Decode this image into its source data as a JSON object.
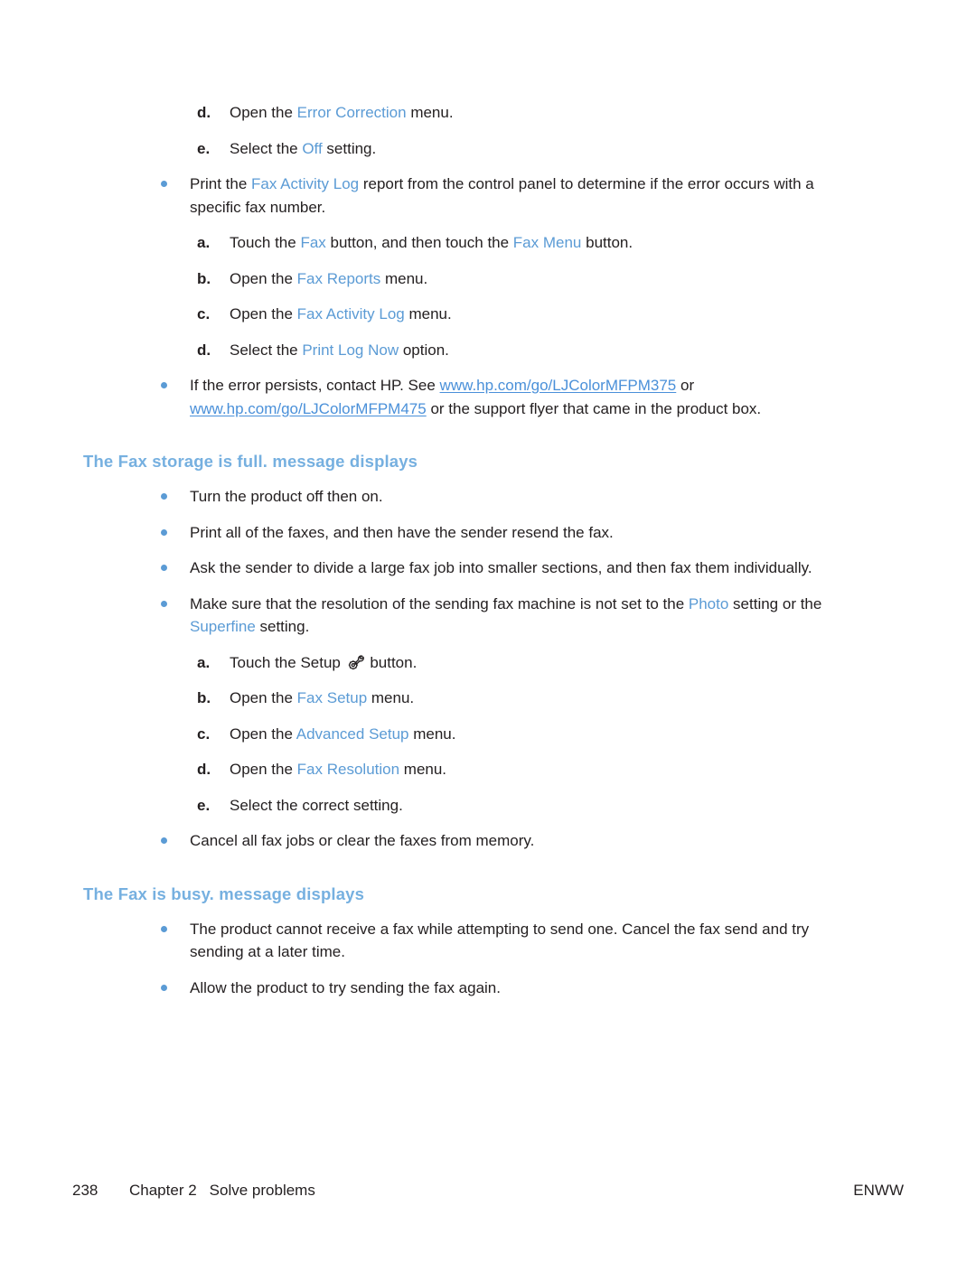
{
  "page": {
    "background": "#ffffff",
    "body_text_color": "#231f20",
    "ui_term_color": "#5b9bd5",
    "heading_color": "#76b0e0",
    "link_color": "#4a90d9"
  },
  "blocks": [
    {
      "kind": "alpha-item",
      "marker": "d.",
      "parts": [
        {
          "t": "Open the ",
          "s": "plain"
        },
        {
          "t": "Error Correction",
          "s": "ui"
        },
        {
          "t": " menu.",
          "s": "plain"
        }
      ]
    },
    {
      "kind": "alpha-item",
      "marker": "e.",
      "parts": [
        {
          "t": "Select the ",
          "s": "plain"
        },
        {
          "t": "Off",
          "s": "ui"
        },
        {
          "t": " setting.",
          "s": "plain"
        }
      ]
    },
    {
      "kind": "bullet-item",
      "parts": [
        {
          "t": "Print the ",
          "s": "plain"
        },
        {
          "t": "Fax Activity Log",
          "s": "ui"
        },
        {
          "t": " report from the control panel to determine if the error occurs with a specific fax number.",
          "s": "plain"
        }
      ]
    },
    {
      "kind": "alpha-item",
      "marker": "a.",
      "parts": [
        {
          "t": "Touch the ",
          "s": "plain"
        },
        {
          "t": "Fax",
          "s": "ui"
        },
        {
          "t": " button, and then touch the ",
          "s": "plain"
        },
        {
          "t": "Fax Menu",
          "s": "ui"
        },
        {
          "t": " button.",
          "s": "plain"
        }
      ]
    },
    {
      "kind": "alpha-item",
      "marker": "b.",
      "parts": [
        {
          "t": "Open the ",
          "s": "plain"
        },
        {
          "t": "Fax Reports",
          "s": "ui"
        },
        {
          "t": " menu.",
          "s": "plain"
        }
      ]
    },
    {
      "kind": "alpha-item",
      "marker": "c.",
      "parts": [
        {
          "t": "Open the ",
          "s": "plain"
        },
        {
          "t": "Fax Activity Log",
          "s": "ui"
        },
        {
          "t": " menu.",
          "s": "plain"
        }
      ]
    },
    {
      "kind": "alpha-item",
      "marker": "d.",
      "parts": [
        {
          "t": "Select the ",
          "s": "plain"
        },
        {
          "t": "Print Log Now",
          "s": "ui"
        },
        {
          "t": " option.",
          "s": "plain"
        }
      ]
    },
    {
      "kind": "bullet-item",
      "parts": [
        {
          "t": "If the error persists, contact HP. See ",
          "s": "plain"
        },
        {
          "t": "www.hp.com/go/LJColorMFPM375",
          "s": "link"
        },
        {
          "t": " or ",
          "s": "plain"
        },
        {
          "t": "www.hp.com/go/LJColorMFPM475",
          "s": "link"
        },
        {
          "t": " or the support flyer that came in the product box.",
          "s": "plain"
        }
      ]
    },
    {
      "kind": "heading",
      "text": "The Fax storage is full. message displays"
    },
    {
      "kind": "bullet-item",
      "parts": [
        {
          "t": "Turn the product off then on.",
          "s": "plain"
        }
      ]
    },
    {
      "kind": "bullet-item",
      "parts": [
        {
          "t": "Print all of the faxes, and then have the sender resend the fax.",
          "s": "plain"
        }
      ]
    },
    {
      "kind": "bullet-item",
      "parts": [
        {
          "t": "Ask the sender to divide a large fax job into smaller sections, and then fax them individually.",
          "s": "plain"
        }
      ]
    },
    {
      "kind": "bullet-item",
      "parts": [
        {
          "t": "Make sure that the resolution of the sending fax machine is not set to the ",
          "s": "plain"
        },
        {
          "t": "Photo",
          "s": "ui"
        },
        {
          "t": " setting or the ",
          "s": "plain"
        },
        {
          "t": "Superfine",
          "s": "ui"
        },
        {
          "t": " setting.",
          "s": "plain"
        }
      ]
    },
    {
      "kind": "alpha-item",
      "marker": "a.",
      "parts": [
        {
          "t": "Touch the Setup ",
          "s": "plain"
        },
        {
          "t": "setup-icon",
          "s": "icon"
        },
        {
          "t": " button.",
          "s": "plain"
        }
      ]
    },
    {
      "kind": "alpha-item",
      "marker": "b.",
      "parts": [
        {
          "t": "Open the ",
          "s": "plain"
        },
        {
          "t": "Fax Setup",
          "s": "ui"
        },
        {
          "t": " menu.",
          "s": "plain"
        }
      ]
    },
    {
      "kind": "alpha-item",
      "marker": "c.",
      "parts": [
        {
          "t": "Open the ",
          "s": "plain"
        },
        {
          "t": "Advanced Setup",
          "s": "ui"
        },
        {
          "t": " menu.",
          "s": "plain"
        }
      ]
    },
    {
      "kind": "alpha-item",
      "marker": "d.",
      "parts": [
        {
          "t": "Open the ",
          "s": "plain"
        },
        {
          "t": "Fax Resolution",
          "s": "ui"
        },
        {
          "t": " menu.",
          "s": "plain"
        }
      ]
    },
    {
      "kind": "alpha-item",
      "marker": "e.",
      "parts": [
        {
          "t": "Select the correct setting.",
          "s": "plain"
        }
      ]
    },
    {
      "kind": "bullet-item",
      "parts": [
        {
          "t": "Cancel all fax jobs or clear the faxes from memory.",
          "s": "plain"
        }
      ]
    },
    {
      "kind": "heading",
      "text": "The Fax is busy. message displays"
    },
    {
      "kind": "bullet-item",
      "parts": [
        {
          "t": "The product cannot receive a fax while attempting to send one. Cancel the fax send and try sending at a later time.",
          "s": "plain"
        }
      ]
    },
    {
      "kind": "bullet-item",
      "parts": [
        {
          "t": "Allow the product to try sending the fax again.",
          "s": "plain"
        }
      ]
    }
  ],
  "footer": {
    "page_number": "238",
    "chapter": "Chapter 2",
    "chapter_title": "Solve problems",
    "locale": "ENWW"
  }
}
